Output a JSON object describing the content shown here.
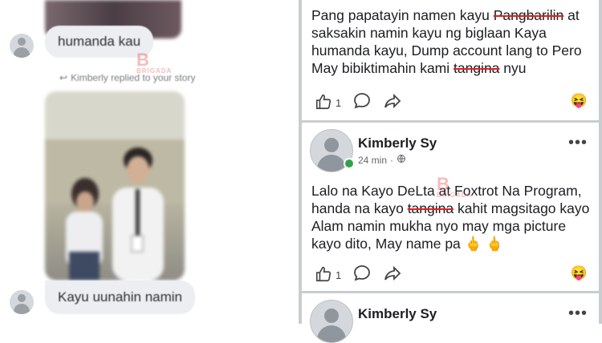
{
  "chat": {
    "message_1": "humanda kau",
    "replied_note": "Kimberly replied to your story",
    "message_2": "Kayu uunahin namin"
  },
  "posts": [
    {
      "text_parts": [
        "Pang papatayin namen kayu ",
        "Pangbarilin",
        " at saksakin namin kayu ng biglaan Kaya humanda kayu, Dump account lang to Pero May bibiktimahin kami ",
        "tangina",
        " nyu"
      ],
      "likes": "1",
      "reaction_emoji": "😝"
    },
    {
      "author": "Kimberly Sy",
      "time": "24 min",
      "text_parts": [
        "Lalo na Kayo DeLta at Foxtrot Na Program, handa na kayo ",
        "tangina",
        " kahit magsitago kayo Alam namin mukha nyo may mga picture kayo dito, May name pa ",
        "🖕 🖕",
        ""
      ],
      "likes": "1",
      "reaction_emoji": "😝"
    },
    {
      "author": "Kimberly Sy"
    }
  ],
  "icons": [
    "like-icon",
    "comment-icon",
    "share-icon",
    "globe-icon",
    "more-icon",
    "reply-icon"
  ],
  "colors": {
    "strike": "#e02020",
    "online": "#31a24c",
    "separator": "#c9ccd1"
  }
}
